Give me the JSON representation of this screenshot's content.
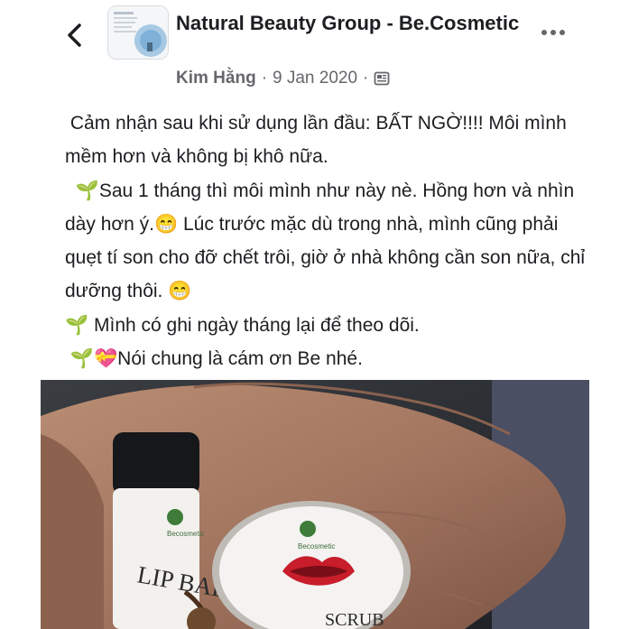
{
  "header": {
    "back_icon": "chevron-left-icon",
    "group_name": "Natural Beauty Group - Be.Cosmetic",
    "author": "Kim Hằng",
    "date": "9 Jan 2020",
    "separator": "·",
    "privacy_icon": "group-privacy-icon",
    "more_icon": "more-horizontal-icon"
  },
  "post": {
    "line1": "Cảm nhận sau khi sử dụng lần đầu: BẤT NGỜ!!!! Môi mình mềm hơn và không bị khô nữa.",
    "line2": "Sau 1 tháng thì môi mình như này nè. Hồng hơn và nhìn dày hơn ý.",
    "line2b": " Lúc trước mặc dù trong nhà, mình cũng phải quẹt tí son cho đỡ chết trôi, giờ ở nhà không cần son nữa, chỉ dưỡng thôi.",
    "line3": " Mình có ghi ngày tháng lại để theo dõi.",
    "line4": "Nói chung là cám ơn Be nhé.",
    "emoji_sprout": "🌱",
    "emoji_grin": "😁",
    "emoji_heart": "💝"
  },
  "photo": {
    "lip_balm_text": "LIP BAL",
    "brand_text": "Becosmetic",
    "scrub_text": "SCRUB"
  },
  "colors": {
    "text": "#1c1e21",
    "meta": "#65676b",
    "background": "#ffffff"
  }
}
